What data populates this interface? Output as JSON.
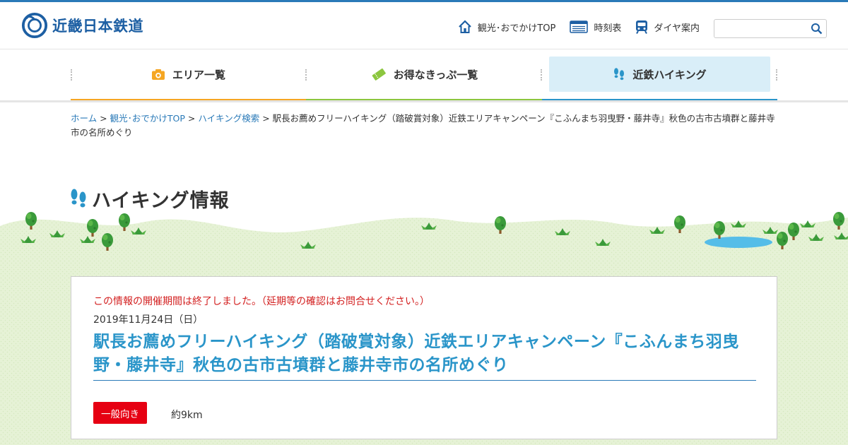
{
  "brand": {
    "name": "近畿日本鉄道"
  },
  "header_nav": [
    {
      "label": "観光･おでかけTOP",
      "icon": "house-icon"
    },
    {
      "label": "時刻表",
      "icon": "timetable-icon"
    },
    {
      "label": "ダイヤ案内",
      "icon": "train-icon"
    }
  ],
  "search": {
    "placeholder": ""
  },
  "global_nav": [
    {
      "label": "エリア一覧",
      "icon": "camera-icon",
      "color": "#f5a623"
    },
    {
      "label": "お得なきっぷ一覧",
      "icon": "ticket-icon",
      "color": "#8cc63f"
    },
    {
      "label": "近鉄ハイキング",
      "icon": "footprints-icon",
      "color": "#2a95c9",
      "active": true
    }
  ],
  "breadcrumb": {
    "links": [
      "ホーム",
      "観光･おでかけTOP",
      "ハイキング検索"
    ],
    "current": "駅長お薦めフリーハイキング（踏破賞対象）近鉄エリアキャンペーン『こふんまち羽曳野・藤井寺』秋色の古市古墳群と藤井寺市の名所めぐり"
  },
  "section_title": "ハイキング情報",
  "event": {
    "notice": "この情報の開催期間は終了しました。（延期等の確認はお問合せください。）",
    "date": "2019年11月24日（日）",
    "title": "駅長お薦めフリーハイキング（踏破賞対象）近鉄エリアキャンペーン『こふんまち羽曳野・藤井寺』秋色の古市古墳群と藤井寺市の名所めぐり",
    "level_badge": "一般向き",
    "distance": "約9km"
  },
  "colors": {
    "brand_blue": "#1d5fa3",
    "title_blue": "#2a95c9",
    "notice_red": "#d32020",
    "badge_red": "#e60012",
    "grass": "#e6f2d6",
    "pond": "#55bde8"
  }
}
